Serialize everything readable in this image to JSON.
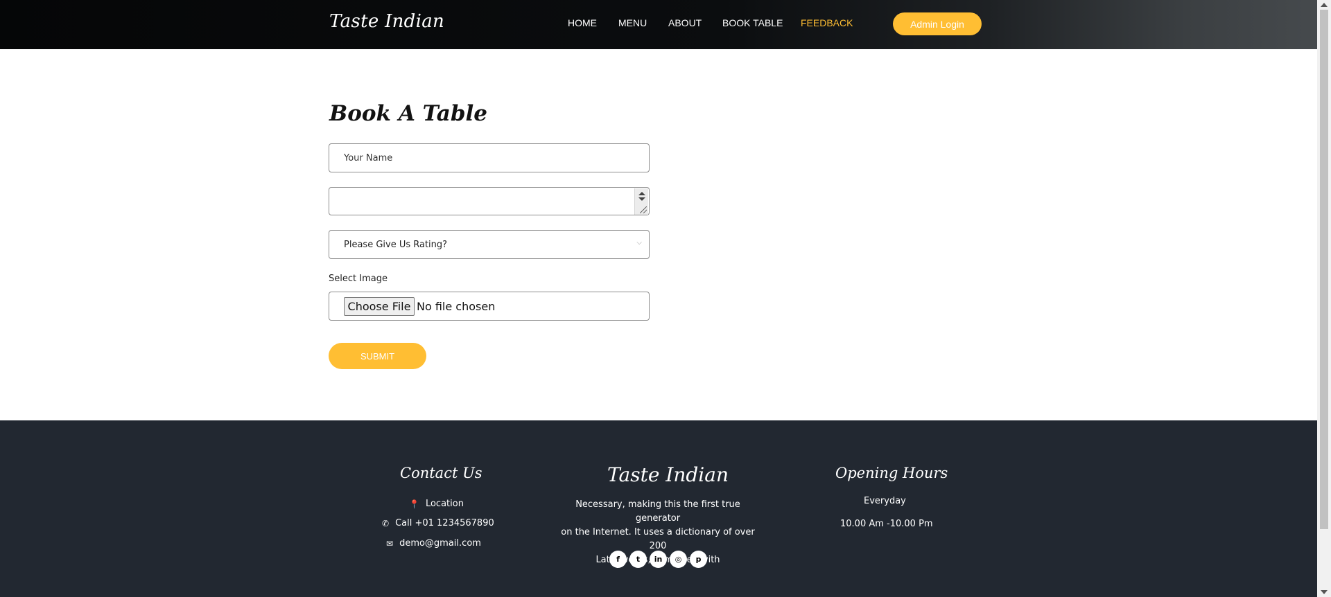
{
  "header": {
    "brand": "Taste Indian",
    "nav": [
      {
        "label": "HOME",
        "active": false
      },
      {
        "label": "MENU",
        "active": false
      },
      {
        "label": "ABOUT",
        "active": false
      },
      {
        "label": "BOOK TABLE",
        "active": false
      },
      {
        "label": "FEEDBACK",
        "active": true
      }
    ],
    "admin_label": "Admin Login"
  },
  "form": {
    "title": "Book A Table",
    "name_placeholder": "Your Name",
    "number_value": "",
    "rating_selected": "Please Give Us Rating?",
    "image_label": "Select Image",
    "choose_file_label": "Choose File",
    "file_status": "No file chosen",
    "submit_label": "SUBMIT"
  },
  "footer": {
    "contact": {
      "heading": "Contact Us",
      "location_icon": "map-marker-icon",
      "location": "Location",
      "phone_icon": "phone-icon",
      "phone": "Call +01 1234567890",
      "email_icon": "envelope-icon",
      "email": "demo@gmail.com"
    },
    "about": {
      "brand": "Taste Indian",
      "line1": "Necessary, making this the first true generator",
      "line2": "on the Internet. It uses a dictionary of over 200",
      "line3": "Latin words, combined with",
      "social": [
        {
          "icon": "facebook-icon",
          "glyph": "f"
        },
        {
          "icon": "twitter-icon",
          "glyph": "t"
        },
        {
          "icon": "linkedin-icon",
          "glyph": "in"
        },
        {
          "icon": "instagram-icon",
          "glyph": "◎"
        },
        {
          "icon": "pinterest-icon",
          "glyph": "p"
        }
      ]
    },
    "hours": {
      "heading": "Opening Hours",
      "days": "Everyday",
      "time": "10.00 Am -10.00 Pm"
    }
  },
  "colors": {
    "accent": "#ffbe33",
    "footer_bg": "#222831",
    "header_bg": "#050607"
  }
}
